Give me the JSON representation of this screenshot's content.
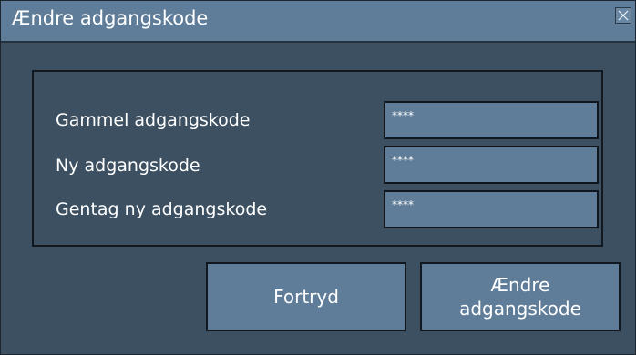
{
  "dialog": {
    "title": "Ændre adgangskode",
    "close_icon": "close-icon"
  },
  "fields": [
    {
      "label": "Gammel adgangskode",
      "value": "****"
    },
    {
      "label": "Ny adgangskode",
      "value": "****"
    },
    {
      "label": "Gentag ny adgangskode",
      "value": "****"
    }
  ],
  "buttons": {
    "cancel_label": "Fortryd",
    "change_label": "Ændre\nadgangskode"
  },
  "colors": {
    "titlebar": "#5f7d99",
    "background": "#3d5061",
    "field": "#5f7d99",
    "text": "#ffffff"
  }
}
